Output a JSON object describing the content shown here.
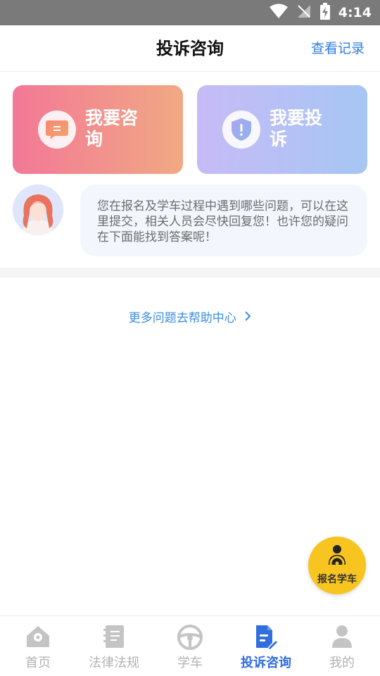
{
  "status_bar": {
    "time": "4:14"
  },
  "header": {
    "title": "投诉咨询",
    "records_link": "查看记录"
  },
  "cards": [
    {
      "label": "我要咨询",
      "icon": "chat-bubble-icon"
    },
    {
      "label": "我要投诉",
      "icon": "shield-alert-icon"
    }
  ],
  "assistant": {
    "avatar": "customer-service-avatar",
    "message": "您在报名及学车过程中遇到哪些问题，可以在这里提交，相关人员会尽快回复您！也许您的疑问在下面能找到答案呢！"
  },
  "help": {
    "label": "更多问题去帮助中心"
  },
  "fab": {
    "label": "报名学车",
    "icon": "driver-wheel-icon",
    "color": "#f8c41f"
  },
  "tabbar": {
    "items": [
      {
        "label": "首页",
        "icon": "home-location-icon",
        "active": false
      },
      {
        "label": "法律法规",
        "icon": "law-book-icon",
        "active": false
      },
      {
        "label": "学车",
        "icon": "steering-wheel-icon",
        "active": false
      },
      {
        "label": "投诉咨询",
        "icon": "complaint-doc-icon",
        "active": true
      },
      {
        "label": "我的",
        "icon": "user-icon",
        "active": false
      }
    ]
  },
  "colors": {
    "accent": "#2f6fde",
    "link": "#3a8de0",
    "inactive": "#b2b2b2"
  }
}
